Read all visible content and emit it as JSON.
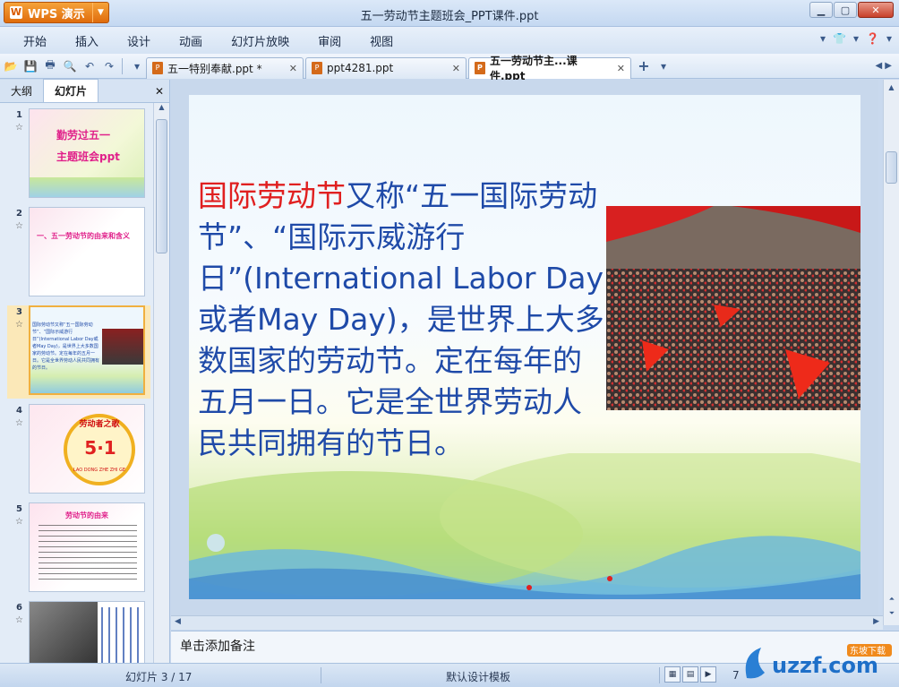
{
  "app": {
    "menu_label": "WPS 演示",
    "window_title": "五一劳动节主题班会_PPT课件.ppt"
  },
  "menu": [
    "开始",
    "插入",
    "设计",
    "动画",
    "幻灯片放映",
    "审阅",
    "视图"
  ],
  "doc_tabs": [
    {
      "label": "五一特别奉献.ppt *"
    },
    {
      "label": "ppt4281.ppt"
    },
    {
      "label": "五一劳动节主...课件.ppt"
    }
  ],
  "left_panel": {
    "tabs": [
      "大纲",
      "幻灯片"
    ],
    "thumbnails": [
      {
        "num": "1",
        "line1": "勤劳过五一",
        "line2": "主题班会ppt"
      },
      {
        "num": "2",
        "text": "一、五一劳动节的由来和含义"
      },
      {
        "num": "3",
        "text": "国际劳动节又称“五一国际劳动节”、“国际示威游行日”(International Labor Day或者May Day)，是世界上大多数国家的劳动节。定在每年的五月一日。它是全世界劳动人民共同拥有的节日。"
      },
      {
        "num": "4",
        "badge": "5·1",
        "ring": "劳动者之歌",
        "sub": "LAO DONG ZHE ZHI GE"
      },
      {
        "num": "5",
        "title": "劳动节的由来"
      },
      {
        "num": "6"
      }
    ]
  },
  "slide": {
    "highlight": "国际劳动节",
    "body": "又称“五一国际劳动节”、“国际示威游行日”(International Labor Day或者May Day)，是世界上大多数国家的劳动节。定在每年的五月一日。它是全世界劳动人民共同拥有的节日。"
  },
  "notes": {
    "placeholder": "单击添加备注"
  },
  "status": {
    "slide_counter": "幻灯片 3 / 17",
    "template": "默认设计模板",
    "zoom": "7"
  },
  "watermark": {
    "brand": "uzzf.com",
    "tagline": "东坡下载"
  },
  "colors": {
    "accent": "#e06c0c",
    "slide_text": "#1f4aa8",
    "highlight": "#e02020"
  }
}
